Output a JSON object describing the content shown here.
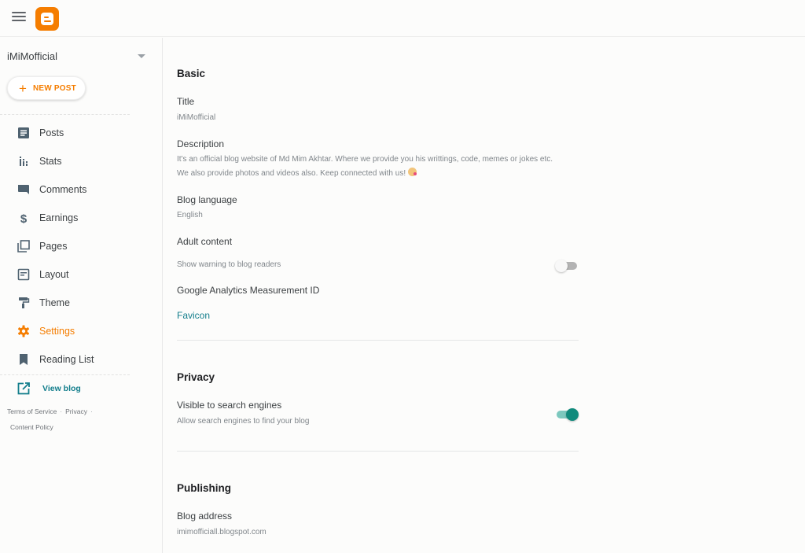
{
  "header": {
    "menu_icon": "hamburger-menu-icon",
    "logo_icon": "blogger-logo-icon",
    "brand_color": "#f57d00"
  },
  "sidebar": {
    "blog_name": "iMiMofficial",
    "new_post_label": "NEW POST",
    "items": [
      {
        "label": "Posts",
        "icon": "posts-icon",
        "active": false
      },
      {
        "label": "Stats",
        "icon": "stats-icon",
        "active": false
      },
      {
        "label": "Comments",
        "icon": "comments-icon",
        "active": false
      },
      {
        "label": "Earnings",
        "icon": "dollar-icon",
        "active": false
      },
      {
        "label": "Pages",
        "icon": "pages-icon",
        "active": false
      },
      {
        "label": "Layout",
        "icon": "layout-icon",
        "active": false
      },
      {
        "label": "Theme",
        "icon": "paint-roller-icon",
        "active": false
      },
      {
        "label": "Settings",
        "icon": "gear-icon",
        "active": true
      },
      {
        "label": "Reading List",
        "icon": "bookmark-icon",
        "active": false
      }
    ],
    "view_blog_label": "View blog",
    "footer": {
      "terms": "Terms of Service",
      "privacy": "Privacy",
      "content_policy": "Content Policy",
      "separator": "·"
    }
  },
  "main": {
    "basic": {
      "heading": "Basic",
      "title_label": "Title",
      "title_value": "iMiMofficial",
      "description_label": "Description",
      "description_line1": "It's an official blog website of Md Mim Akhtar. Where we provide you his writtings, code, memes or jokes etc.",
      "description_line2": "We also provide photos and videos also. Keep connected with us!",
      "language_label": "Blog language",
      "language_value": "English",
      "adult_label": "Adult content",
      "adult_sub": "Show warning to blog readers",
      "adult_enabled": false,
      "analytics_label": "Google Analytics Measurement ID",
      "favicon_label": "Favicon"
    },
    "privacy": {
      "heading": "Privacy",
      "visible_label": "Visible to search engines",
      "visible_sub": "Allow search engines to find your blog",
      "visible_enabled": true
    },
    "publishing": {
      "heading": "Publishing",
      "address_label": "Blog address",
      "address_value": "imimofficiall.blogspot.com"
    }
  }
}
